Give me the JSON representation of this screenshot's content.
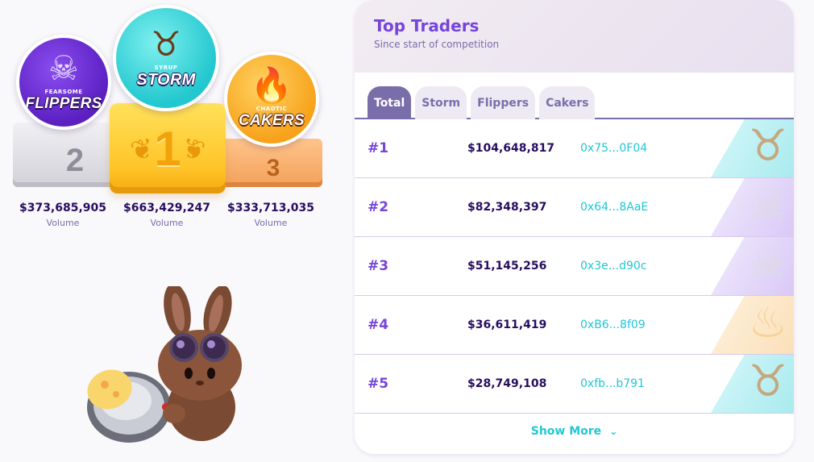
{
  "podium": {
    "places": [
      {
        "rank": "2",
        "team": "FLIPPERS",
        "badge_small": "FEARSOME",
        "icon": "skull-icon",
        "volume": "$373,685,905",
        "volume_label": "Volume"
      },
      {
        "rank": "1",
        "team": "STORM",
        "badge_small": "SYRUP",
        "icon": "bull-icon",
        "volume": "$663,429,247",
        "volume_label": "Volume"
      },
      {
        "rank": "3",
        "team": "CAKERS",
        "badge_small": "CHAOTIC",
        "icon": "flame-icon",
        "volume": "$333,713,035",
        "volume_label": "Volume"
      }
    ]
  },
  "panel": {
    "title": "Top Traders",
    "subtitle": "Since start of competition",
    "tabs": [
      {
        "label": "Total",
        "active": true
      },
      {
        "label": "Storm",
        "active": false
      },
      {
        "label": "Flippers",
        "active": false
      },
      {
        "label": "Cakers",
        "active": false
      }
    ],
    "rows": [
      {
        "rank": "#1",
        "volume": "$104,648,817",
        "address": "0x75...0F04",
        "team": "storm"
      },
      {
        "rank": "#2",
        "volume": "$82,348,397",
        "address": "0x64...8AaE",
        "team": "flippers"
      },
      {
        "rank": "#3",
        "volume": "$51,145,256",
        "address": "0x3e...d90c",
        "team": "flippers"
      },
      {
        "rank": "#4",
        "volume": "$36,611,419",
        "address": "0xB6...8f09",
        "team": "cakers"
      },
      {
        "rank": "#5",
        "volume": "$28,749,108",
        "address": "0xfb...b791",
        "team": "storm"
      }
    ],
    "show_more": "Show More"
  },
  "colors": {
    "accent_purple": "#7645d9",
    "text_dark": "#280d5f",
    "text_muted": "#7a6eaa",
    "address_cyan": "#1fc7d4",
    "gold": "#ffc52a",
    "silver": "#d2d1d8",
    "bronze": "#f3a05a"
  }
}
